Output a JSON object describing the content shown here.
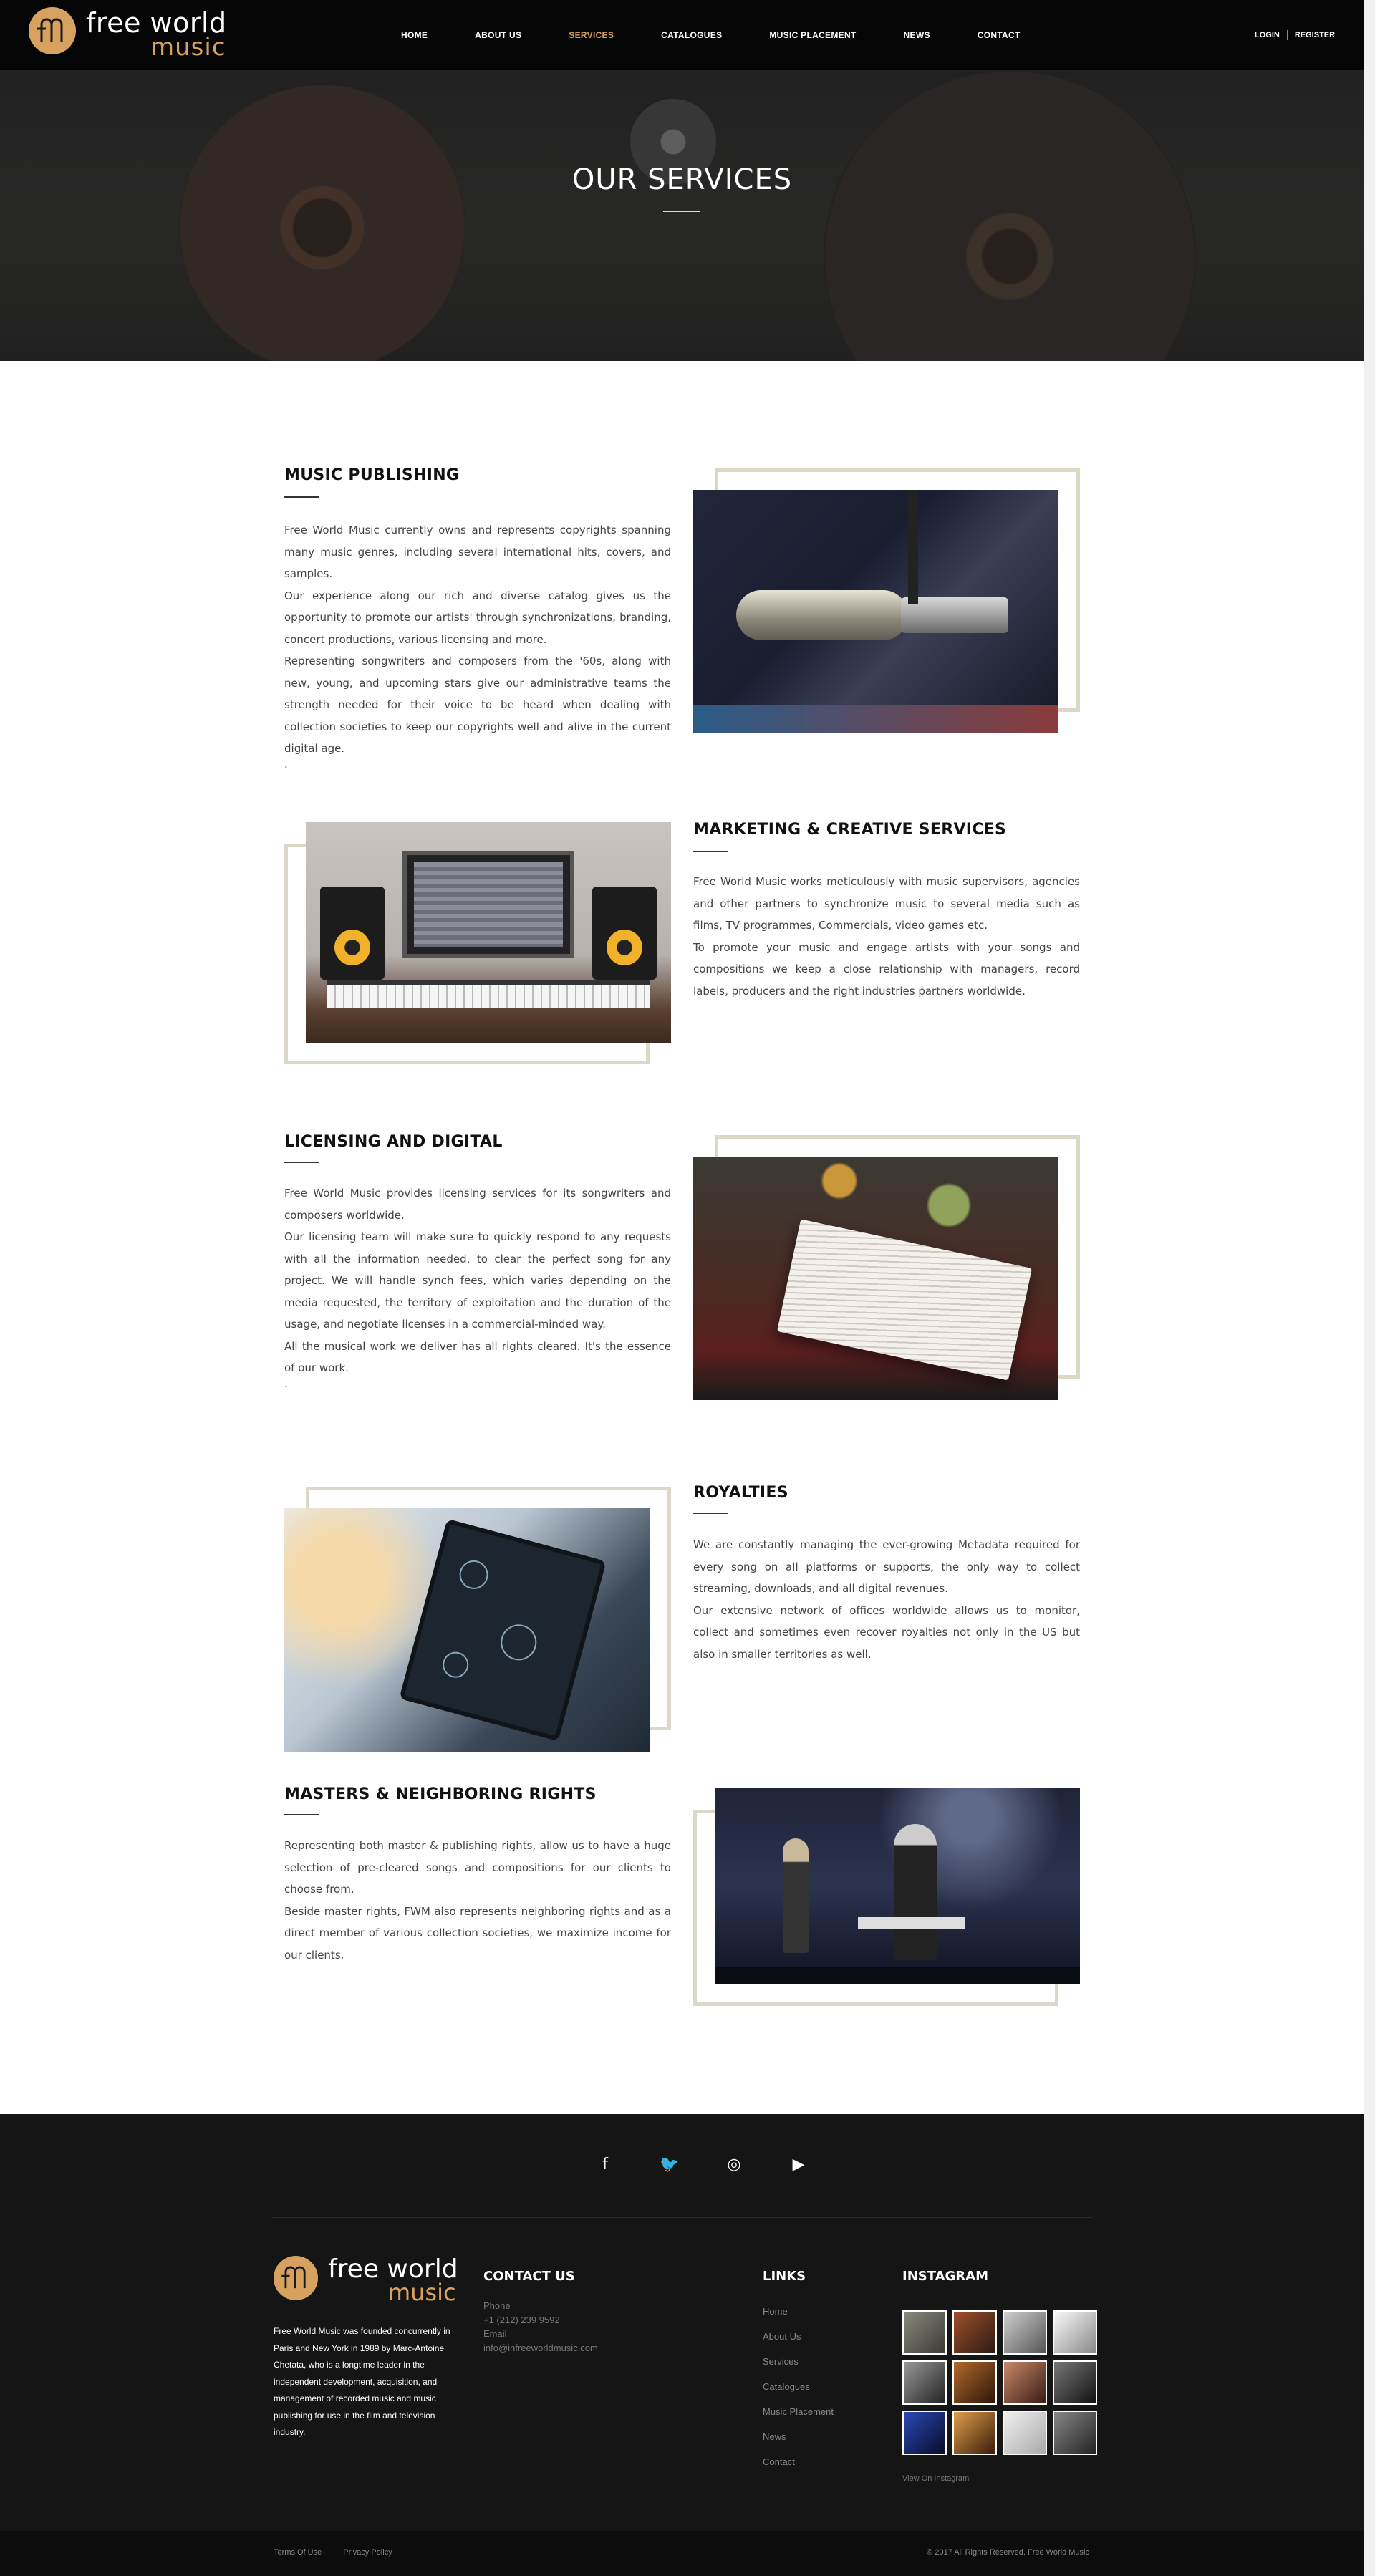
{
  "brand": {
    "name_line1": "free world",
    "name_line2": "music",
    "accent": "#d7a25f"
  },
  "nav": {
    "items": [
      "HOME",
      "ABOUT US",
      "SERVICES",
      "CATALOGUES",
      "MUSIC PLACEMENT",
      "NEWS",
      "CONTACT"
    ],
    "active": "SERVICES",
    "login": "LOGIN",
    "register": "REGISTER"
  },
  "hero": {
    "title": "OUR SERVICES"
  },
  "sections": [
    {
      "title": "MUSIC PUBLISHING",
      "paragraphs": [
        "Free World Music currently owns and represents copyrights spanning many music genres, including several international hits, covers, and samples.",
        "Our experience along our rich and diverse catalog gives us the opportunity to promote our artists' through synchronizations, branding, concert productions, various licensing and more.",
        "Representing songwriters and composers from the '60s, along with new, young, and upcoming stars give our administrative teams the strength needed for their voice to be heard when dealing with collection societies to keep our copyrights well and alive in the current digital age.",
        "."
      ]
    },
    {
      "title": "MARKETING & CREATIVE SERVICES",
      "paragraphs": [
        "Free World Music works meticulously with music supervisors, agencies and other partners to synchronize music to several media such as films, TV programmes, Commercials, video games etc.",
        "To promote your music and engage artists with your songs and compositions we keep a close relationship with managers, record labels, producers and the right industries partners worldwide."
      ]
    },
    {
      "title": "LICENSING AND DIGITAL",
      "paragraphs": [
        "Free World Music provides licensing services for its songwriters and composers worldwide.",
        "Our licensing team will make sure to quickly respond to any requests with all the information needed, to clear the perfect song for any project. We will handle synch fees, which varies depending on the media requested, the territory of exploitation and the duration of the usage, and negotiate licenses in a commercial-minded way.",
        "All the musical work we deliver has all rights cleared. It's the essence of our work.",
        "."
      ]
    },
    {
      "title": "ROYALTIES",
      "paragraphs": [
        "We are constantly managing the ever-growing Metadata required for every song on all platforms or supports, the only way to collect streaming, downloads, and all digital revenues.",
        "Our extensive network of offices worldwide allows us to monitor, collect and sometimes even recover royalties not only in the US but also in smaller territories as well."
      ]
    },
    {
      "title": "MASTERS & NEIGHBORING RIGHTS",
      "paragraphs": [
        "Representing both master & publishing rights, allow us to have a huge selection of pre-cleared songs and compositions for our clients to choose from.",
        "Beside master rights, FWM also represents neighboring rights and as a direct member of various collection societies, we maximize income for our clients."
      ]
    }
  ],
  "footer": {
    "social_icons": [
      "facebook-icon",
      "twitter-icon",
      "instagram-icon",
      "youtube-icon"
    ],
    "social_glyphs": [
      "f",
      "🐦",
      "◎",
      "▶"
    ],
    "about": "Free World Music was founded concurrently in Paris and New York in 1989 by Marc-Antoine Chetata, who is a longtime leader in the independent development, acquisition, and management of recorded music and music publishing for use in the film and television industry.",
    "contact_heading": "CONTACT US",
    "phone_label": "Phone",
    "phone": "+1 (212) 239 9592",
    "email_label": "Email",
    "email": "info@infreeworldmusic.com",
    "links_heading": "LINKS",
    "links": [
      "Home",
      "About Us",
      "Services",
      "Catalogues",
      "Music Placement",
      "News",
      "Contact"
    ],
    "instagram_heading": "INSTAGRAM",
    "view_instagram": "View On Instagram",
    "terms": "Terms Of Use",
    "privacy": "Privacy Policy",
    "copyright": "© 2017 All Rights Reserved. Free World Music"
  }
}
